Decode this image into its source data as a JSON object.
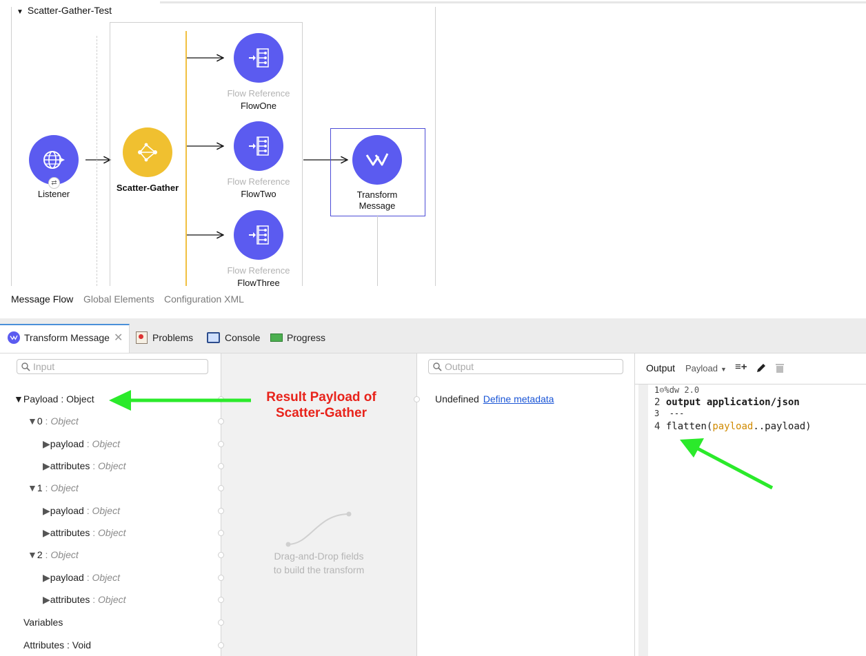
{
  "flow": {
    "name": "Scatter-Gather-Test",
    "nodes": {
      "listener": "Listener",
      "scatter_gather": "Scatter-Gather",
      "flow_ref_type": "Flow Reference",
      "flow_one": "FlowOne",
      "flow_two": "FlowTwo",
      "flow_three": "FlowThree",
      "transform_line1": "Transform",
      "transform_line2": "Message"
    },
    "colors": {
      "connector": "#5b5bf0",
      "router": "#f0c030"
    }
  },
  "editor_tabs": [
    "Message Flow",
    "Global Elements",
    "Configuration XML"
  ],
  "panel": {
    "tabs": {
      "transform": "Transform Message",
      "problems": "Problems",
      "console": "Console",
      "progress": "Progress"
    },
    "input_placeholder": "Input",
    "output_placeholder": "Output",
    "input_tree": {
      "payload": "Payload : Object",
      "items": [
        {
          "index": "0",
          "type": "Object"
        },
        {
          "index": "1",
          "type": "Object"
        },
        {
          "index": "2",
          "type": "Object"
        }
      ],
      "child_payload": "payload",
      "child_attributes": "attributes",
      "child_type": "Object",
      "variables": "Variables",
      "attributes": "Attributes : Void"
    },
    "mapping_hint_line1": "Drag-and-Drop fields",
    "mapping_hint_line2": "to build the transform",
    "output_undefined": "Undefined",
    "output_define": "Define metadata",
    "script_toolbar": {
      "output_label": "Output",
      "payload_select": "Payload"
    },
    "code": {
      "line1_num": "1",
      "line1": "%dw 2.0",
      "line2_num": "2",
      "line2": "output application/json",
      "line3_num": "3",
      "line3": "---",
      "line4_num": "4",
      "line4_a": "flatten(",
      "line4_b": "payload",
      "line4_c": "..payload)"
    }
  },
  "annotation": {
    "line1": "Result Payload of",
    "line2": "Scatter-Gather",
    "arrow_color": "#22ee22",
    "text_color": "#e8231b"
  }
}
